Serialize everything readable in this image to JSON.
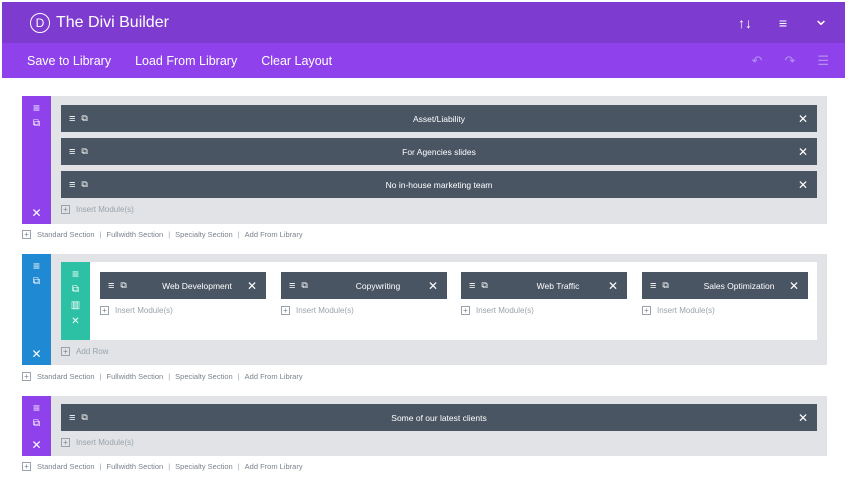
{
  "app": {
    "logo_letter": "D",
    "title": "The Divi Builder"
  },
  "top_icons": {
    "sort": "↑↓",
    "menu": "≡",
    "collapse": "⌄"
  },
  "menu": {
    "save": "Save to Library",
    "load": "Load From Library",
    "clear": "Clear Layout"
  },
  "history_icons": {
    "undo": "↶",
    "redo": "↷",
    "history": "☰"
  },
  "sections": [
    {
      "modules": [
        "Asset/Liability",
        "For Agencies slides",
        "No in-house marketing team"
      ],
      "insert_label": "Insert Module(s)"
    },
    {
      "columns": [
        {
          "module": "Web Development",
          "insert_label": "Insert Module(s)"
        },
        {
          "module": "Copywriting",
          "insert_label": "Insert Module(s)"
        },
        {
          "module": "Web Traffic",
          "insert_label": "Insert Module(s)"
        },
        {
          "module": "Sales Optimization",
          "insert_label": "Insert Module(s)"
        }
      ],
      "add_row_label": "Add Row"
    },
    {
      "modules": [
        "Some of our latest clients"
      ],
      "insert_label": "Insert Module(s)"
    }
  ],
  "section_links": {
    "standard": "Standard Section",
    "fullwidth": "Fullwidth Section",
    "specialty": "Specialty Section",
    "library": "Add From Library",
    "separator": "|",
    "plus": "+"
  },
  "icons": {
    "hamburger": "≡",
    "copy": "⧉",
    "close": "✕",
    "columns": "▥",
    "plus": "+"
  }
}
